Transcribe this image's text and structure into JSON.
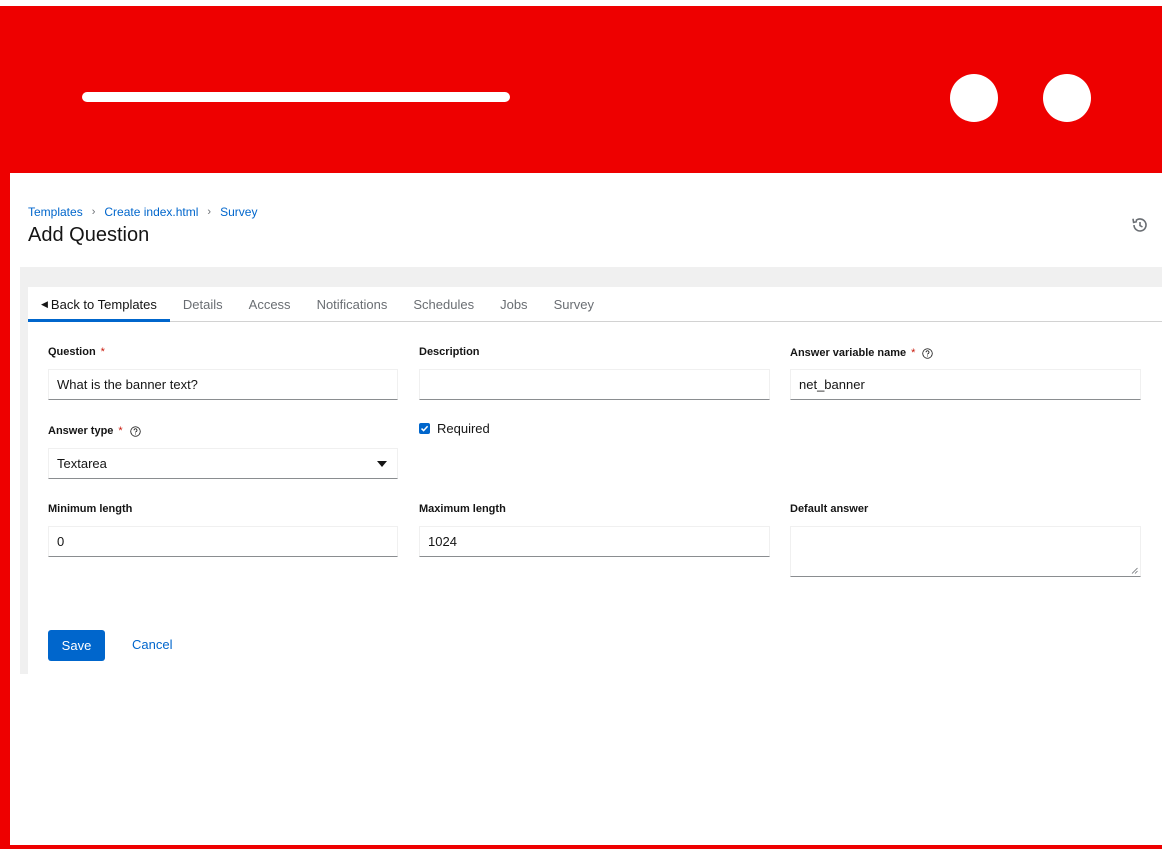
{
  "breadcrumb": {
    "items": [
      "Templates",
      "Create index.html",
      "Survey"
    ]
  },
  "page": {
    "title": "Add Question"
  },
  "tabs": {
    "back": "Back to Templates",
    "details": "Details",
    "access": "Access",
    "notifications": "Notifications",
    "schedules": "Schedules",
    "jobs": "Jobs",
    "survey": "Survey"
  },
  "form": {
    "question": {
      "label": "Question",
      "required_mark": "*",
      "value": "What is the banner text?"
    },
    "description": {
      "label": "Description",
      "value": ""
    },
    "variable": {
      "label": "Answer variable name",
      "required_mark": "*",
      "value": "net_banner"
    },
    "answer_type": {
      "label": "Answer type",
      "required_mark": "*",
      "value": "Textarea"
    },
    "required": {
      "label": "Required",
      "checked": true
    },
    "min_length": {
      "label": "Minimum length",
      "value": "0"
    },
    "max_length": {
      "label": "Maximum length",
      "value": "1024"
    },
    "default_answer": {
      "label": "Default answer",
      "value": ""
    }
  },
  "actions": {
    "save": "Save",
    "cancel": "Cancel"
  },
  "icons": {
    "history": "history-icon",
    "help": "help-circle-icon",
    "caret": "caret-left-icon",
    "dropdown": "caret-down-icon",
    "checkbox": "check-icon"
  },
  "colors": {
    "frame": "#ee0000",
    "accent": "#0066cc",
    "required": "#c9190b"
  }
}
